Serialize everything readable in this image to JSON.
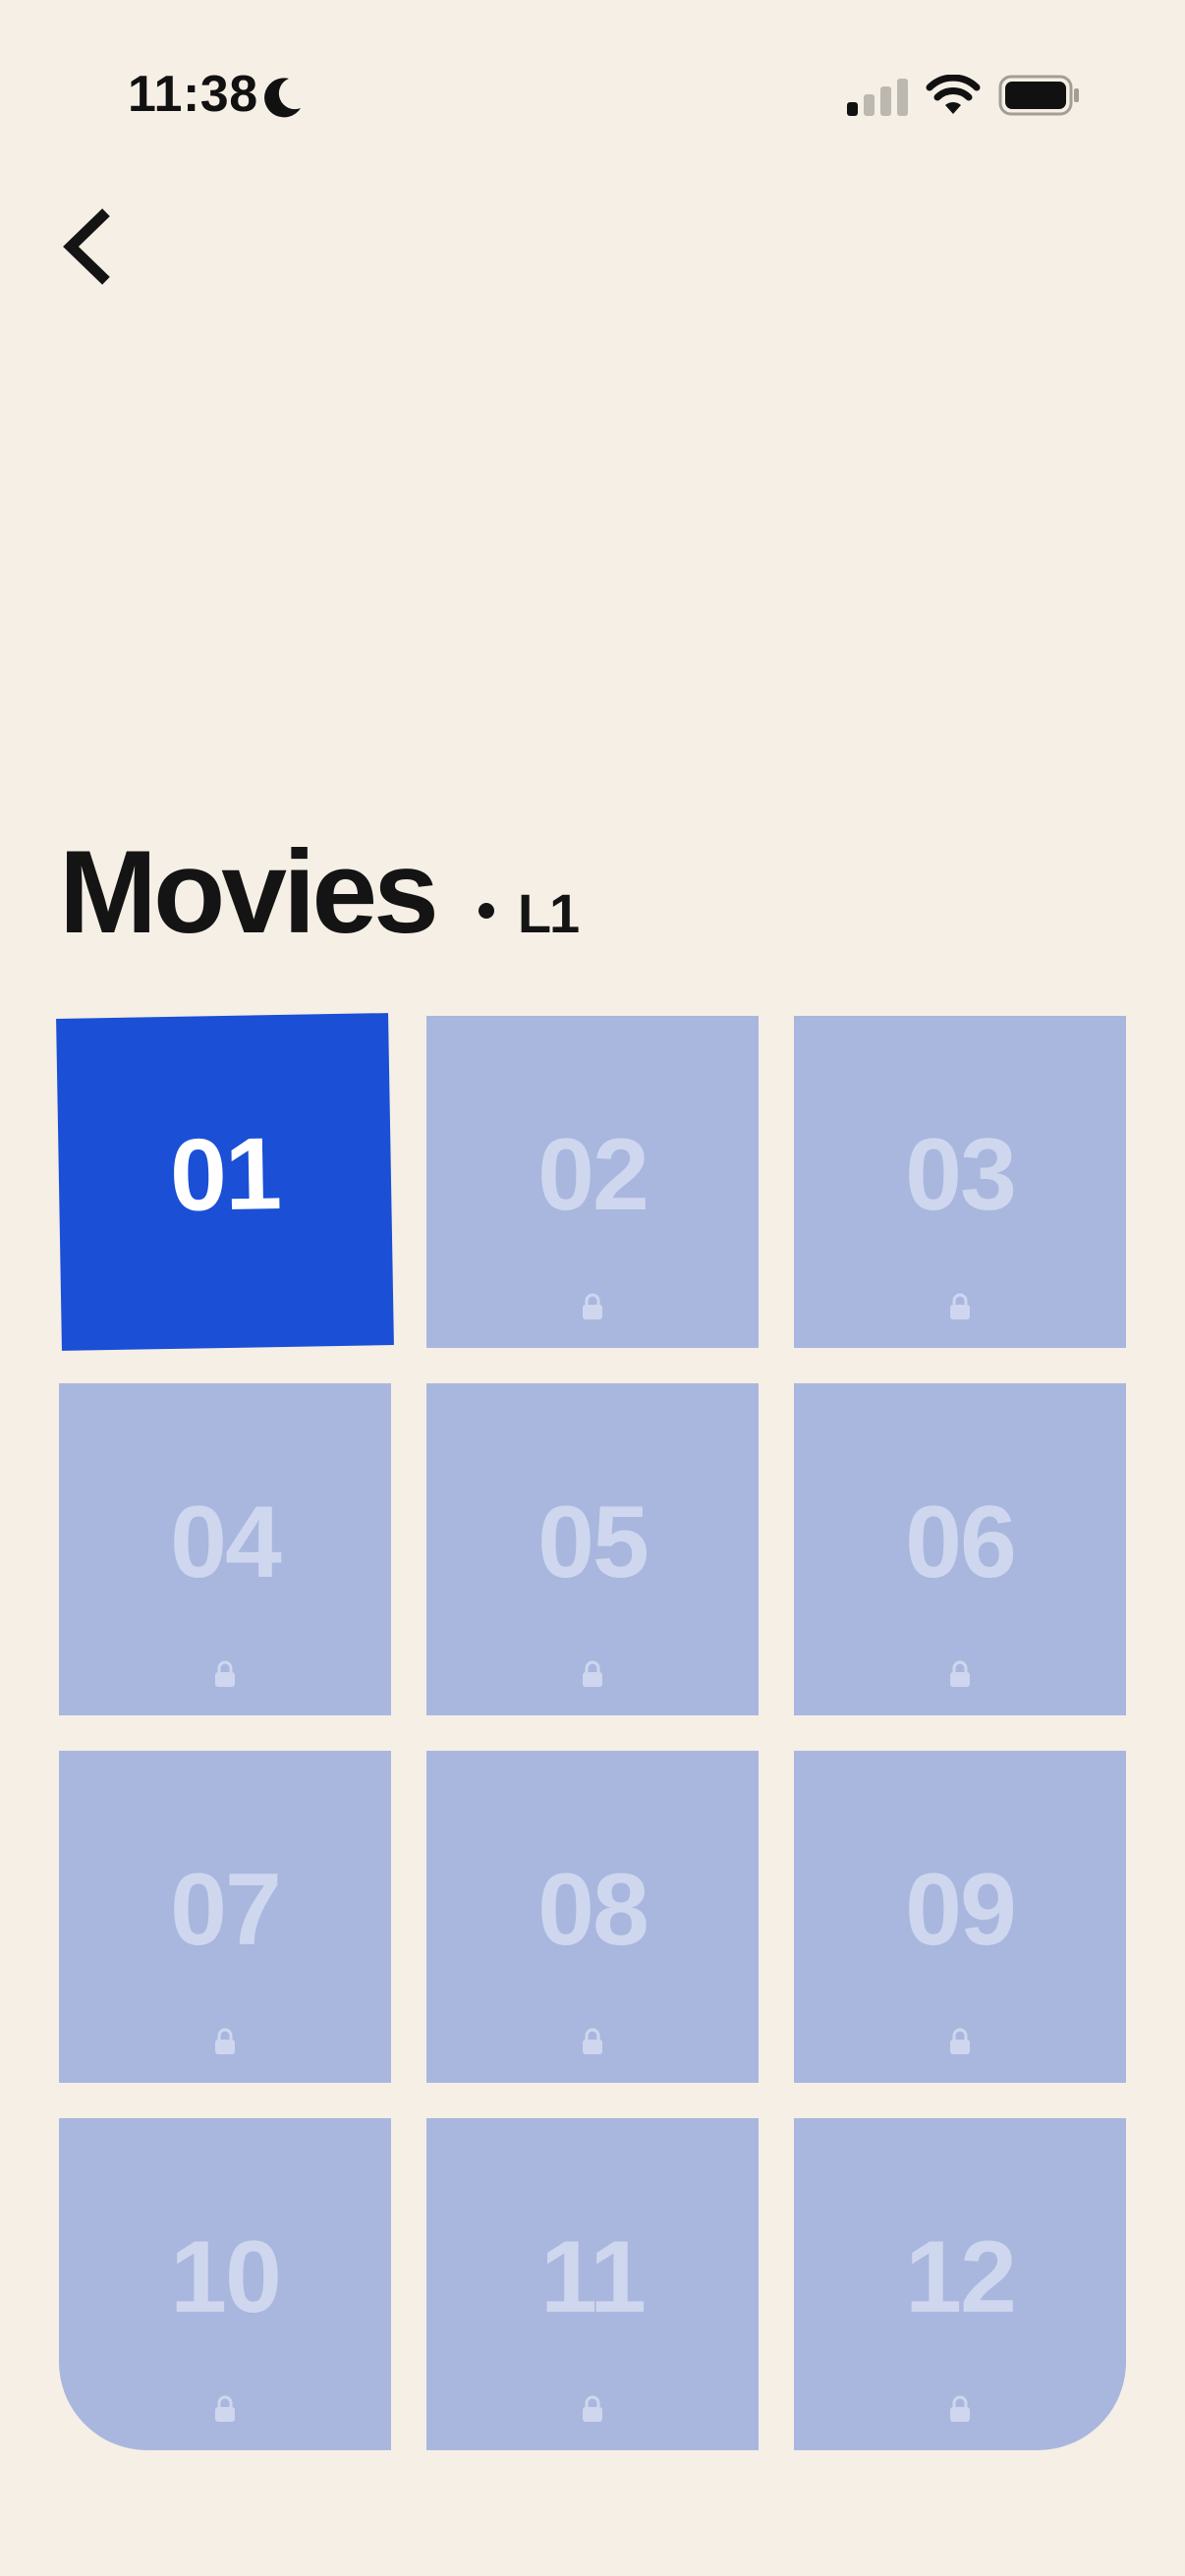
{
  "status_bar": {
    "time": "11:38",
    "focus_icon": "moon-icon",
    "signal_icon": "cellular-signal-icon",
    "wifi_icon": "wifi-icon",
    "battery_icon": "battery-icon"
  },
  "header": {
    "back_icon": "chevron-left-icon"
  },
  "title": {
    "text": "Movies",
    "level": "L1"
  },
  "colors": {
    "background": "#F5EFE5",
    "active_tile": "#1A4FD6",
    "locked_tile": "#A9B7DF",
    "locked_number": "#CFD7EE",
    "text": "#141414"
  },
  "levels": [
    {
      "number": "01",
      "state": "unlocked",
      "icon": ""
    },
    {
      "number": "02",
      "state": "locked",
      "icon": "lock-icon"
    },
    {
      "number": "03",
      "state": "locked",
      "icon": "lock-icon"
    },
    {
      "number": "04",
      "state": "locked",
      "icon": "lock-icon"
    },
    {
      "number": "05",
      "state": "locked",
      "icon": "lock-icon"
    },
    {
      "number": "06",
      "state": "locked",
      "icon": "lock-icon"
    },
    {
      "number": "07",
      "state": "locked",
      "icon": "lock-icon"
    },
    {
      "number": "08",
      "state": "locked",
      "icon": "lock-icon"
    },
    {
      "number": "09",
      "state": "locked",
      "icon": "lock-icon"
    },
    {
      "number": "10",
      "state": "locked",
      "icon": "lock-icon"
    },
    {
      "number": "11",
      "state": "locked",
      "icon": "lock-icon"
    },
    {
      "number": "12",
      "state": "locked",
      "icon": "lock-icon"
    }
  ]
}
